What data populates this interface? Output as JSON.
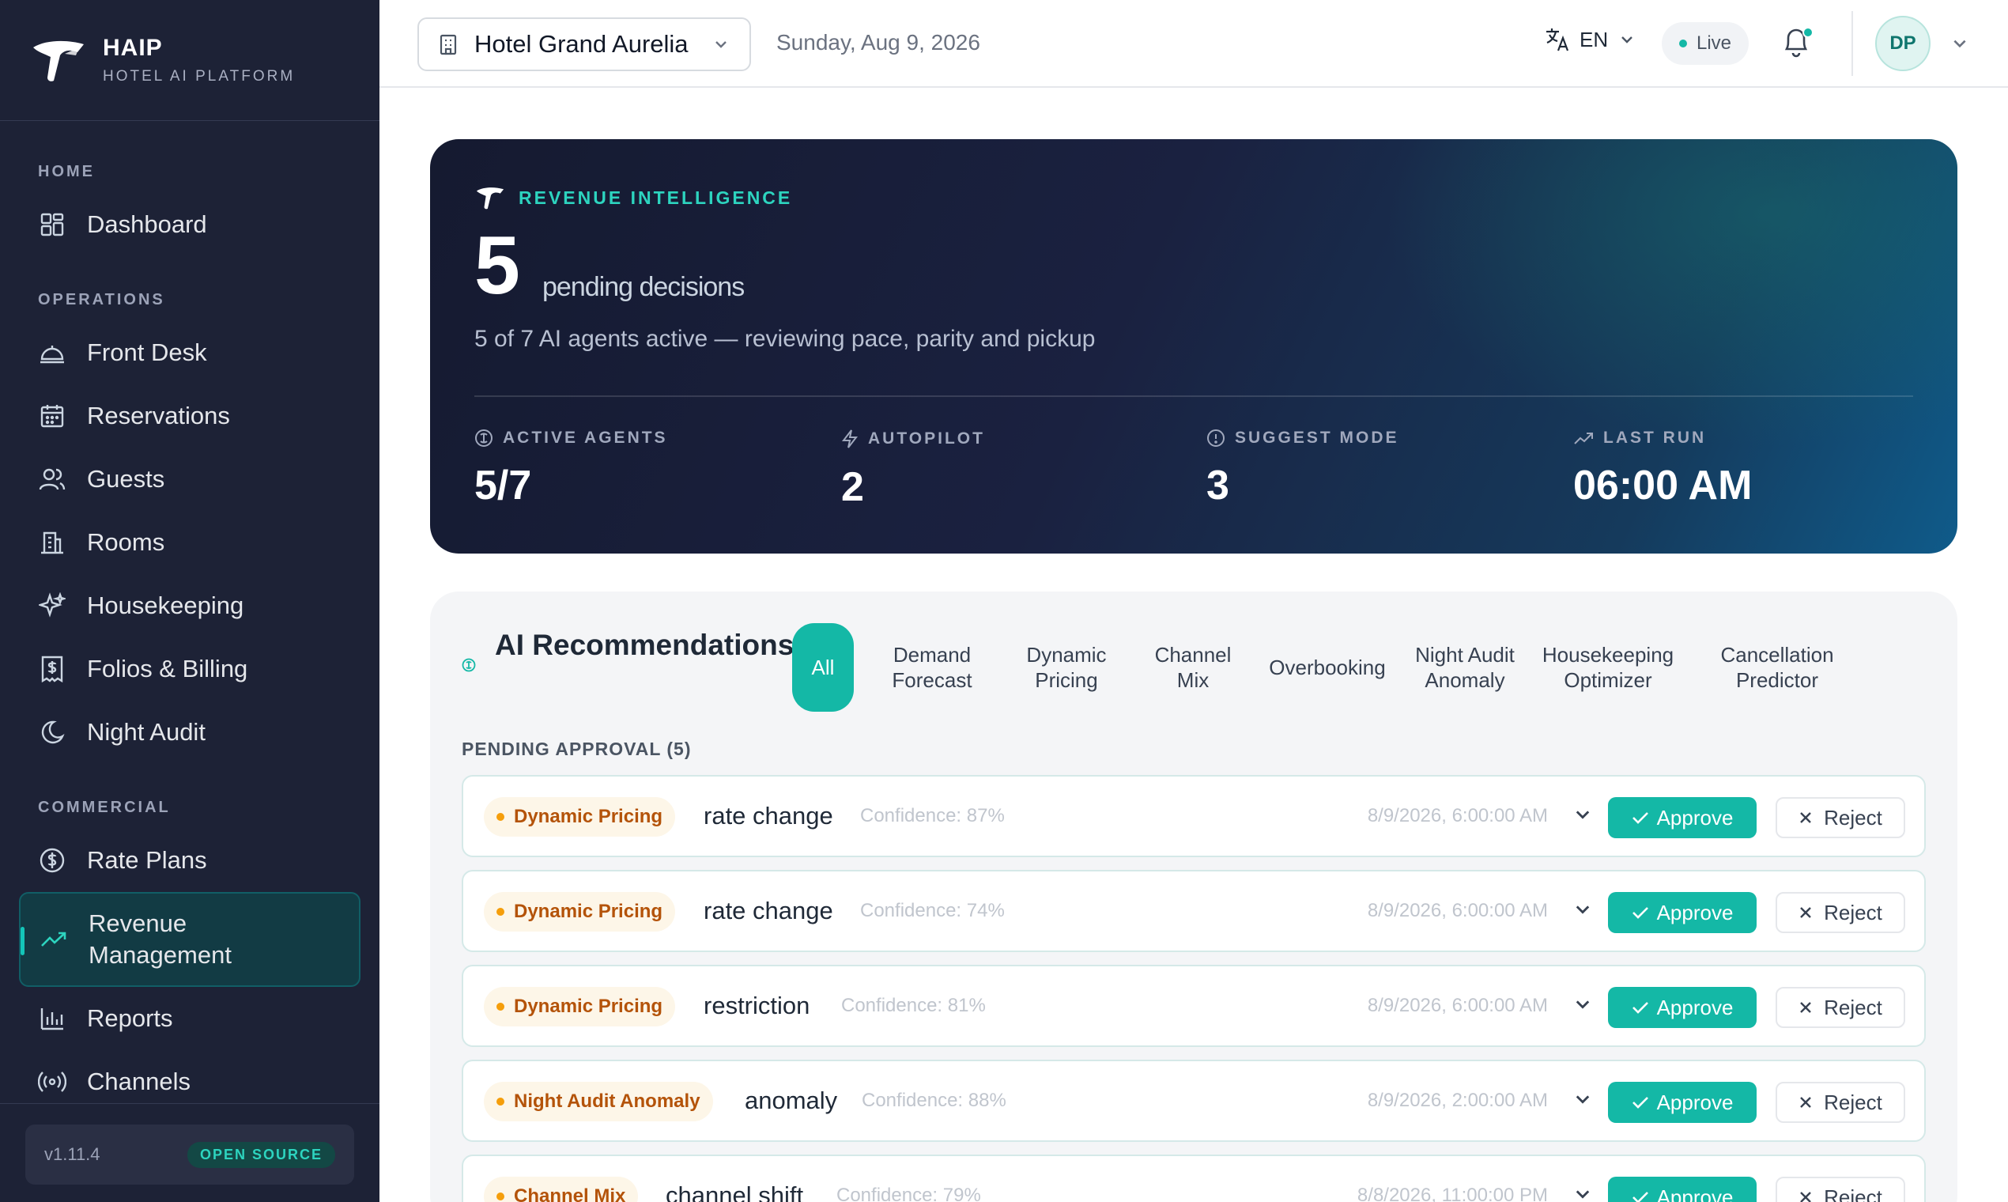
{
  "brand": {
    "name": "HAIP",
    "subtitle": "HOTEL AI PLATFORM"
  },
  "sidebar": {
    "sections": [
      {
        "label": "HOME"
      },
      {
        "label": "OPERATIONS"
      },
      {
        "label": "COMMERCIAL"
      }
    ],
    "items": [
      {
        "label": "Dashboard",
        "icon": "dashboard-icon"
      },
      {
        "label": "Front Desk",
        "icon": "bell-desk-icon"
      },
      {
        "label": "Reservations",
        "icon": "calendar-icon"
      },
      {
        "label": "Guests",
        "icon": "users-icon"
      },
      {
        "label": "Rooms",
        "icon": "building-icon"
      },
      {
        "label": "Housekeeping",
        "icon": "sparkle-icon"
      },
      {
        "label": "Folios & Billing",
        "icon": "receipt-icon"
      },
      {
        "label": "Night Audit",
        "icon": "moon-icon"
      },
      {
        "label": "Rate Plans",
        "icon": "dollar-circle-icon"
      },
      {
        "label": "Revenue Management",
        "icon": "trending-up-icon",
        "active": true
      },
      {
        "label": "Reports",
        "icon": "bar-chart-icon"
      },
      {
        "label": "Channels",
        "icon": "broadcast-icon"
      }
    ],
    "footer": {
      "version": "v1.11.4",
      "badge": "OPEN SOURCE"
    }
  },
  "topbar": {
    "hotel": "Hotel Grand Aurelia",
    "date": "Sunday, Aug 9, 2026",
    "language": "EN",
    "live_label": "Live",
    "user_initials": "DP"
  },
  "hero": {
    "eyebrow": "REVENUE INTELLIGENCE",
    "pending_count": "5",
    "pending_label": "pending decisions",
    "subtitle": "5 of 7 AI agents active — reviewing pace, parity and pickup",
    "stats": [
      {
        "label": "ACTIVE AGENTS",
        "value": "5/7",
        "icon": "agent-icon"
      },
      {
        "label": "AUTOPILOT",
        "value": "2",
        "icon": "lightning-icon"
      },
      {
        "label": "SUGGEST MODE",
        "value": "3",
        "icon": "alert-circle-icon"
      },
      {
        "label": "LAST RUN",
        "value": "06:00 AM",
        "icon": "trend-arrow-icon"
      }
    ]
  },
  "recommendations": {
    "title": "AI Recommendations",
    "tabs": [
      {
        "label": "All",
        "active": true
      },
      {
        "label": "Demand Forecast"
      },
      {
        "label": "Dynamic Pricing"
      },
      {
        "label": "Channel Mix"
      },
      {
        "label": "Overbooking"
      },
      {
        "label": "Night Audit Anomaly"
      },
      {
        "label": "Housekeeping Optimizer"
      },
      {
        "label": "Cancellation Predictor"
      }
    ],
    "section_label": "PENDING APPROVAL (5)",
    "approve_label": "Approve",
    "reject_label": "Reject",
    "items": [
      {
        "agent": "Dynamic Pricing",
        "type": "rate change",
        "confidence": "Confidence: 87%",
        "time": "8/9/2026, 6:00:00 AM"
      },
      {
        "agent": "Dynamic Pricing",
        "type": "rate change",
        "confidence": "Confidence: 74%",
        "time": "8/9/2026, 6:00:00 AM"
      },
      {
        "agent": "Dynamic Pricing",
        "type": "restriction",
        "confidence": "Confidence: 81%",
        "time": "8/9/2026, 6:00:00 AM"
      },
      {
        "agent": "Night Audit Anomaly",
        "type": "anomaly",
        "confidence": "Confidence: 88%",
        "time": "8/9/2026, 2:00:00 AM"
      },
      {
        "agent": "Channel Mix",
        "type": "channel shift",
        "confidence": "Confidence: 79%",
        "time": "8/8/2026, 11:00:00 PM"
      }
    ]
  },
  "colors": {
    "accent": "#14b8a6",
    "sidebar_bg": "#1d2236",
    "badge_text": "#b45309"
  }
}
